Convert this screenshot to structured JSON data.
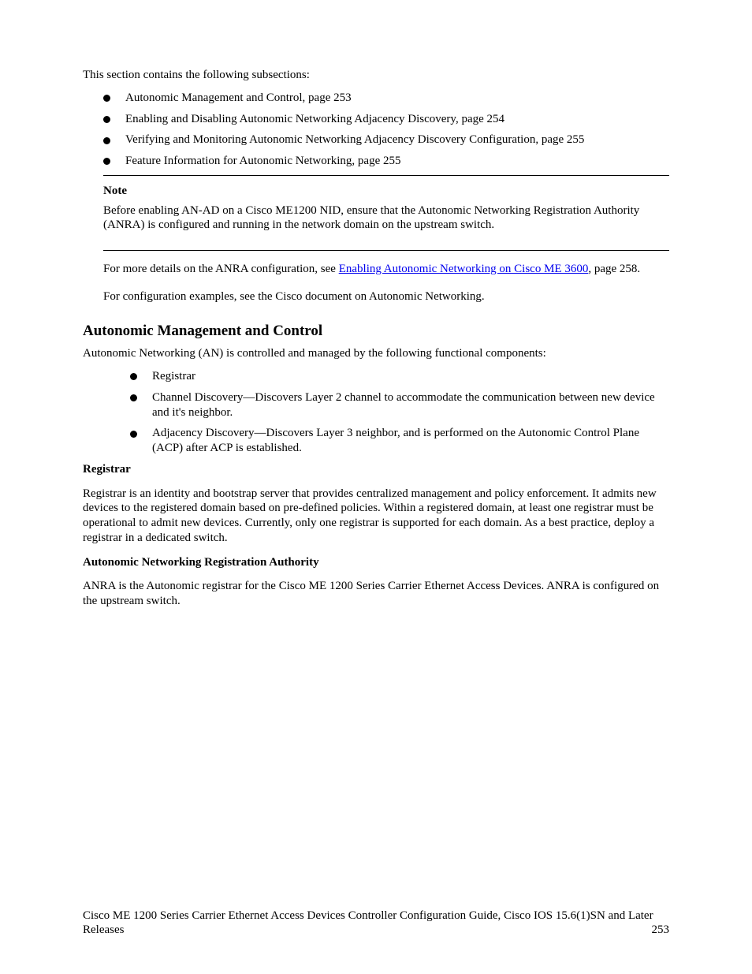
{
  "intro": {
    "p1": "This section contains the following subsections:",
    "bullets": [
      "Autonomic Management and Control, page 253",
      "Enabling and Disabling Autonomic Networking Adjacency Discovery, page 254",
      "Verifying and Monitoring Autonomic Networking Adjacency Discovery Configuration, page 255",
      "Feature Information for Autonomic Networking, page 255"
    ]
  },
  "notebox": {
    "title": "Note",
    "text": "Before enabling AN-AD on a Cisco ME1200 NID, ensure that the Autonomic Networking Registration Authority (ANRA) is configured and running in the network domain on the upstream switch."
  },
  "seealso": {
    "prefix": "For more details on the ANRA configuration, see ",
    "link_text": "Enabling Autonomic Networking on Cisco ME 3600",
    "page_text": ", page 258."
  },
  "cfg": {
    "text": "For configuration examples, see the Cisco document on Autonomic Networking."
  },
  "section": {
    "title": "Autonomic Management and Control",
    "p1": "Autonomic Networking (AN) is controlled and managed by the following functional components:",
    "bullets": [
      "Registrar",
      "Channel Discovery—Discovers Layer 2 channel to accommodate the communication between new device and it's neighbor.",
      "Adjacency Discovery—Discovers Layer 3 neighbor, and is performed on the Autonomic Control Plane (ACP) after ACP is established."
    ],
    "p_registrar_title": "Registrar",
    "p_registrar_body": "Registrar is an identity and bootstrap server that provides centralized management and policy enforcement. It admits new devices to the registered domain based on pre-defined policies. Within a registered domain, at least one registrar must be operational to admit new devices. Currently, only one registrar is supported for each domain. As a best practice, deploy a registrar in a dedicated switch.",
    "p_anra_title": "Autonomic Networking Registration Authority",
    "p_anra_body": "ANRA is the Autonomic registrar for the Cisco ME 1200 Series Carrier Ethernet Access Devices. ANRA is configured on the upstream switch."
  },
  "footer": {
    "left": "Cisco ME 1200 Series Carrier Ethernet Access Devices Controller Configuration Guide, Cisco IOS 15.6(1)SN and Later Releases",
    "right": "253"
  }
}
